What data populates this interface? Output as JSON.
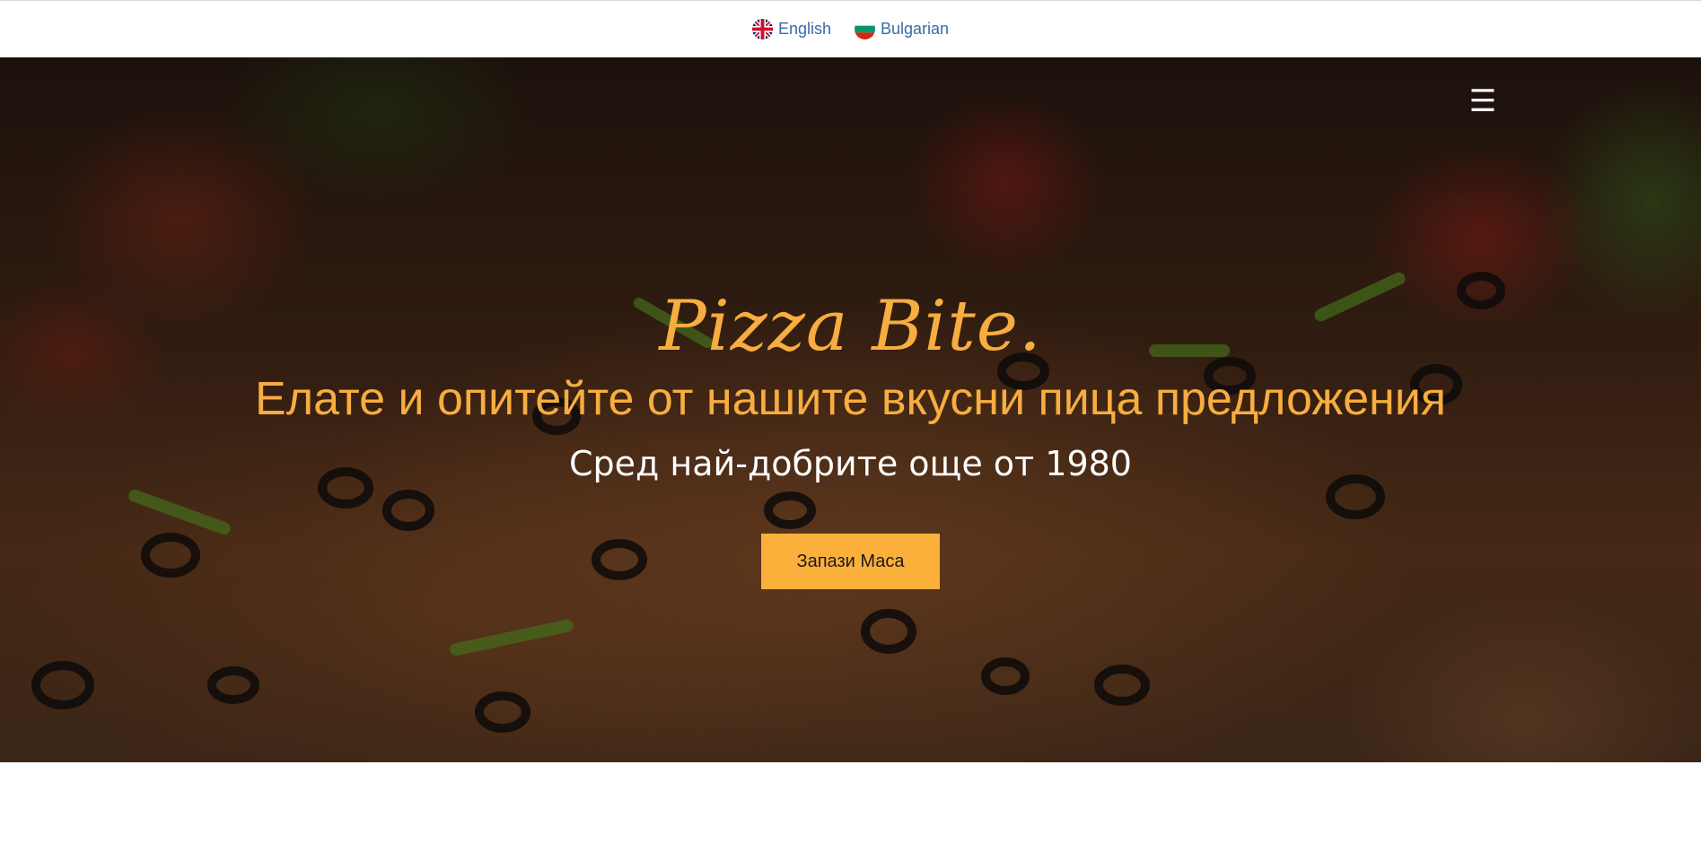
{
  "languages": [
    {
      "label": "English",
      "icon": "uk-flag-icon"
    },
    {
      "label": "Bulgarian",
      "icon": "bulgaria-flag-icon"
    }
  ],
  "hero": {
    "brand": "Pizza Bite.",
    "headline": "Елате и опитейте от нашите вкусни пица предложения",
    "subline": "Сред най-добрите още от 1980",
    "cta_label": "Запази Маса",
    "menu_icon": "hamburger-menu-icon"
  },
  "colors": {
    "accent": "#f7ad3f",
    "button": "#fbb03b",
    "link": "#3a6aa8"
  }
}
